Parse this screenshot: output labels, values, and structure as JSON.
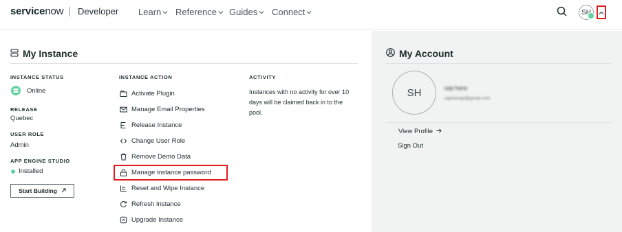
{
  "header": {
    "brand": "servicenow",
    "brand_sub": "Developer",
    "nav": [
      {
        "label": "Learn"
      },
      {
        "label": "Reference"
      },
      {
        "label": "Guides"
      },
      {
        "label": "Connect"
      }
    ],
    "avatar_initials": "SH"
  },
  "my_instance": {
    "title": "My Instance",
    "instance_status_label": "INSTANCE STATUS",
    "instance_status_value": "Online",
    "release_label": "RELEASE",
    "release_value": "Quebec",
    "user_role_label": "USER ROLE",
    "user_role_value": "Admin",
    "app_engine_label": "APP ENGINE STUDIO",
    "app_engine_value": "Installed",
    "start_building": "Start Building",
    "instance_action_label": "INSTANCE ACTION",
    "actions": [
      {
        "label": "Activate Plugin",
        "icon": "plugin-icon"
      },
      {
        "label": "Manage Email Properties",
        "icon": "mail-icon"
      },
      {
        "label": "Release Instance",
        "icon": "release-icon"
      },
      {
        "label": "Change User Role",
        "icon": "code-icon"
      },
      {
        "label": "Remove Demo Data",
        "icon": "trash-icon"
      },
      {
        "label": "Manage instance password",
        "icon": "lock-icon"
      },
      {
        "label": "Reset and Wipe Instance",
        "icon": "reset-icon"
      },
      {
        "label": "Refresh Instance",
        "icon": "refresh-icon"
      },
      {
        "label": "Upgrade Instance",
        "icon": "upgrade-icon"
      }
    ],
    "activity_label": "ACTIVITY",
    "activity_text": "Instances with no activity for over 10 days will be claimed back in to the pool."
  },
  "my_account": {
    "title": "My Account",
    "avatar_initials": "SH",
    "name": "sap hana",
    "email": "saphanapl@gmail.com",
    "view_profile": "View Profile",
    "sign_out": "Sign Out"
  },
  "colors": {
    "accent_green": "#62d2a2",
    "highlight_red": "#e01b1b",
    "panel_gray": "#f1f2f2"
  }
}
